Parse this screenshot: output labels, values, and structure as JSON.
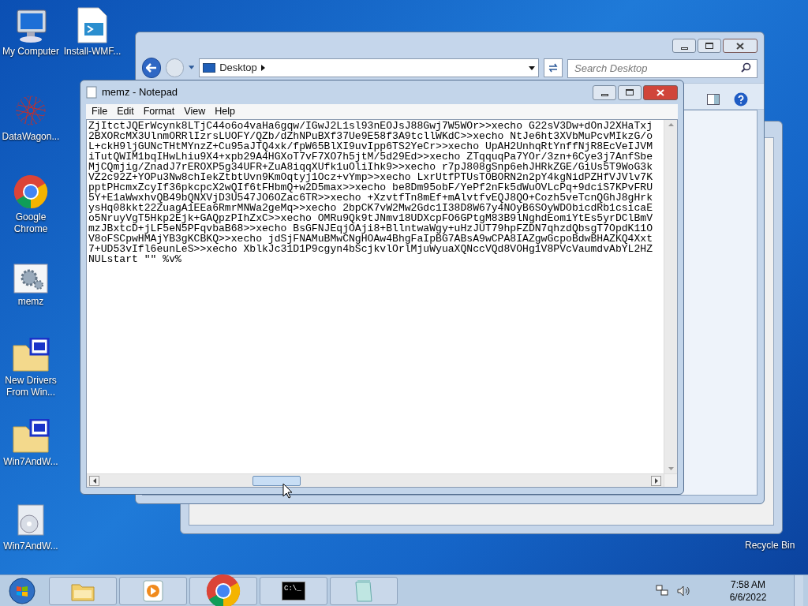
{
  "desktop_icons": [
    {
      "label": "My Computer",
      "kind": "computer"
    },
    {
      "label": "Install-WMF...",
      "kind": "script"
    },
    {
      "label": "DataWagon...",
      "kind": "network"
    },
    {
      "label": "Google Chrome",
      "kind": "chrome"
    },
    {
      "label": "memz",
      "kind": "settings"
    },
    {
      "label": "New Drivers From Win...",
      "kind": "iso"
    },
    {
      "label": "Win7AndW...",
      "kind": "zip"
    },
    {
      "label": "Win7AndW...",
      "kind": "installer"
    },
    {
      "label": "Recycle Bin",
      "kind": "label"
    }
  ],
  "explorer": {
    "address": "Desktop",
    "search_placeholder": "Search Desktop"
  },
  "notepad": {
    "title": "memz - Notepad",
    "menu": [
      "File",
      "Edit",
      "Format",
      "View",
      "Help"
    ],
    "lines": [
      "ZjItctJQErWcynk8LTjC44o6o4vaHa6gqw/IGwJ2L1sl93nEOJsJ88Gwj7W5WOr>>xecho G22sV3Dw+dOnJ2XHaTxj",
      "2BXORcMX3UlnmORRlIzrsLUOFY/QZb/dZhNPuBXf37Ue9E58f3A9tcllWKdC>>xecho NtJe6ht3XVbMuPcvMIkzG/o",
      "L+ckH9ljGUNcTHtMYnzZ+Cu95aJTQ4xk/fpW65BlXI9uvIpp6TS2YeCr>>xecho UpAH2UnhqRtYnffNjR8EcVeIJVM",
      "iTutQWIM1bqIHwLhiu9X4+xpb29A4HGXoT7vF7XO7h5jtM/5d29Ed>>xecho ZTqquqPa7YOr/3zn+6Cye3j7AnfSbe",
      "MjCQmjig/ZnadJ7rEROXP5g34UFR+ZuA8iqqXUfk1uOliIhk9>>xecho r7pJ808gSnp6ehJHRkZGE/GiUs5T9WoG3k",
      "VZ2c92Z+YOPu3Nw8chIekZtbtUvn9KmOqtyj1Ocz+vYmp>>xecho LxrUtfPTUsTOBORN2n2pY4kgNidPZHfVJVlv7K",
      "pptPHcmxZcyIf36pkcpcX2wQIf6tFHbmQ+w2D5max>>xecho be8Dm95obF/YePf2nFk5dWuOVLcPq+9dciS7KPvFRU",
      "5Y+E1aWwxhvQB49bQNXVjD3U547JO6OZac6TR>>xecho +XzvtfTn8mEf+mAlvtfvEQJ8QO+Cozh5veTcnQGhJ8gHrk",
      "ysHq08kkt22ZuagA1EEa6RmrMNWa2geMq>>xecho 2bpCK7vW2Mw2Gdc1I38D8W67y4NOyB6SOyWDObicdRb1csicaE",
      "o5NruyVgT5Hkp2Ejk+GAQpzPIhZxC>>xecho OMRu9Qk9tJNmv18UDXcpFO6GPtgM83B9lNghdEomiYtEs5yrDClBmV",
      "mzJBxtcD+jLF5eN5PFqvbaB68>>xecho BsGFNJEqjOAji8+BllntwaWgy+uHzJUT79hpFZDN7qhzdQbsgT7OpdK11O",
      "V8oFSCpwHMAjYB3gKCBKQ>>xecho jdSjFNAMuBMwCNgHOAw4BhgFaIpBG7ABsA9wCPA8IAZgwGcpoBdwBHAZKQ4Xxt",
      "7+UD53vIfl6eunLeS>>xecho XblkJc31D1P9cgyn4bScjkvlOrlMjuWyuaXQNccVQd8VOHg1V8PVcVaumdvAbYL2HZ",
      "NULstart \"\" %v%"
    ]
  },
  "taskbar": {
    "items": [
      {
        "kind": "explorer"
      },
      {
        "kind": "media"
      },
      {
        "kind": "chrome"
      },
      {
        "kind": "cmd",
        "label": "C:\\_"
      },
      {
        "kind": "notepad"
      }
    ],
    "time": "7:58 AM",
    "date": "6/6/2022"
  }
}
